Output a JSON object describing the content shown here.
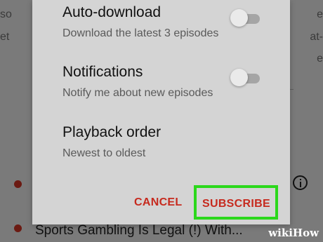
{
  "background": {
    "left_lines": [
      "so",
      "et"
    ],
    "right_lines": [
      "e",
      "at-",
      "e"
    ],
    "bottom_title": "Sports Gambling Is Legal (!) With..."
  },
  "dialog": {
    "auto_download": {
      "title": "Auto-download",
      "subtitle": "Download the latest 3 episodes",
      "enabled": false
    },
    "notifications": {
      "title": "Notifications",
      "subtitle": "Notify me about new episodes",
      "enabled": false
    },
    "playback_order": {
      "title": "Playback order",
      "value": "Newest to oldest"
    },
    "buttons": {
      "cancel": "CANCEL",
      "subscribe": "SUBSCRIBE"
    }
  },
  "colors": {
    "accent": "#c62a1e",
    "highlight": "#2bd81b"
  },
  "watermark": "wikiHow"
}
